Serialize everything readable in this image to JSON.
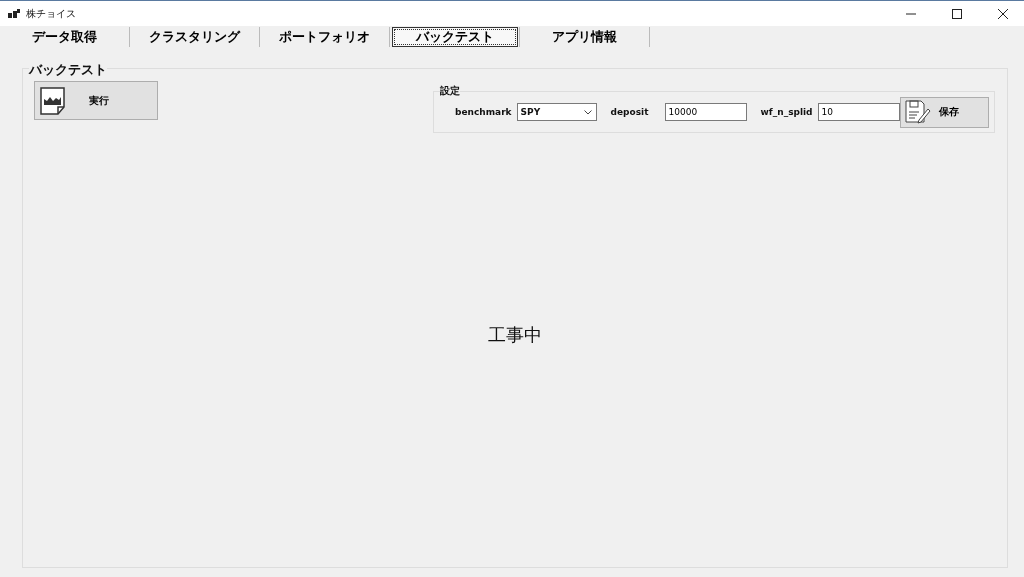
{
  "window": {
    "title": "株チョイス"
  },
  "tabs": [
    {
      "label": "データ取得",
      "selected": false
    },
    {
      "label": "クラスタリング",
      "selected": false
    },
    {
      "label": "ポートフォリオ",
      "selected": false
    },
    {
      "label": "バックテスト",
      "selected": true
    },
    {
      "label": "アプリ情報",
      "selected": false
    }
  ],
  "panel": {
    "title": "バックテスト",
    "run_button": "実行",
    "message": "工事中",
    "settings": {
      "title": "設定",
      "benchmark_label": "benchmark",
      "benchmark_value": "SPY",
      "deposit_label": "deposit",
      "deposit_value": "10000",
      "split_label": "wf_n_splid",
      "split_value": "10",
      "save_button": "保存"
    }
  }
}
